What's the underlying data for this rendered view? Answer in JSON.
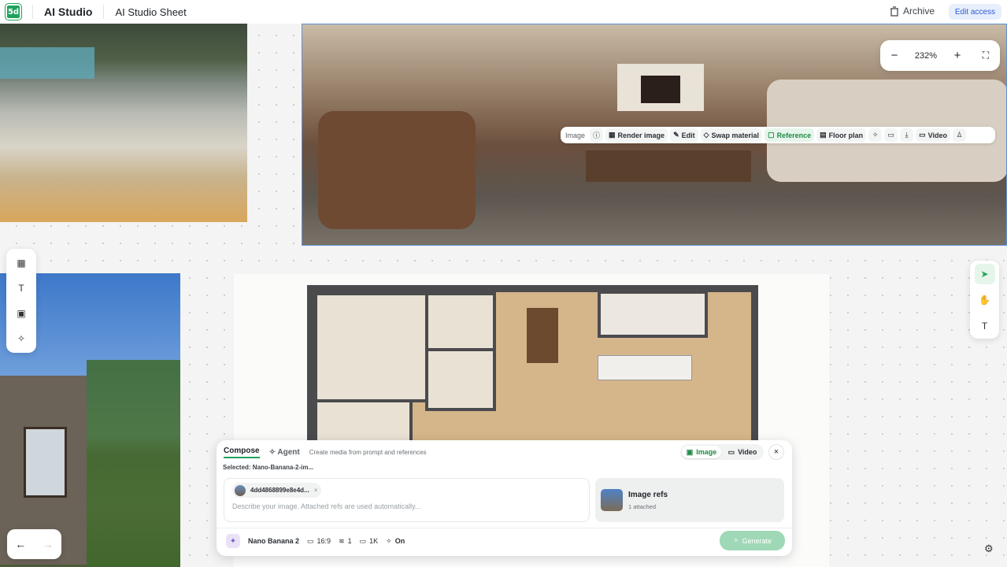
{
  "header": {
    "logo": "5d",
    "app_title": "AI Studio",
    "sheet_title": "AI Studio Sheet",
    "archive_label": "Archive",
    "edit_access_label": "Edit access"
  },
  "zoom": {
    "minus": "−",
    "level": "232%",
    "plus": "+",
    "fullscreen": "⛶"
  },
  "image_toolbar": {
    "label": "Image",
    "info": "ⓘ",
    "render_image": "Render image",
    "edit": "Edit",
    "swap_material": "Swap material",
    "reference": "Reference",
    "floor_plan": "Floor plan",
    "video": "Video"
  },
  "left_tools": [
    "grid-icon",
    "text-icon",
    "image-icon",
    "sparkle-icon"
  ],
  "right_tools": [
    "cursor-icon",
    "hand-icon",
    "text-icon"
  ],
  "nav": {
    "back": "←",
    "forward": "→"
  },
  "compose": {
    "tab_compose": "Compose",
    "tab_agent": "Agent",
    "subtitle": "Create media from prompt and references",
    "mode_image": "Image",
    "mode_video": "Video",
    "close": "×",
    "selected": "Selected: Nano-Banana-2-im...",
    "chip_label": "4dd4868899e8e4d...",
    "chip_remove": "×",
    "placeholder": "Describe your image. Attached refs are used automatically...",
    "refs_title": "Image refs",
    "refs_count": "1 attached",
    "model": "Nano Banana 2",
    "aspect": "16:9",
    "count": "1",
    "resolution": "1K",
    "enhance": "On",
    "generate": "Generate"
  },
  "colors": {
    "accent": "#1fa35c",
    "selection": "#5f8fd7",
    "edit_access": "#2f5bd3"
  }
}
